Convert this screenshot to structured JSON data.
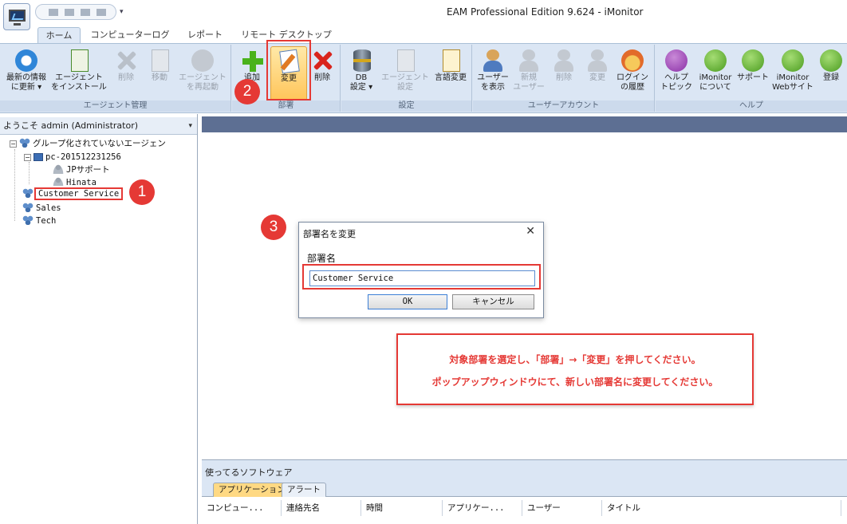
{
  "window": {
    "title": "EAM Professional Edition 9.624 - iMonitor",
    "qat_dropdown_glyph": "▾"
  },
  "ribbon_tabs": [
    {
      "label": "ホーム"
    },
    {
      "label": "コンピューターログ"
    },
    {
      "label": "レポート"
    },
    {
      "label": "リモート デスクトップ"
    }
  ],
  "ribbon": {
    "agent_mgmt": {
      "group_label": "エージェント管理",
      "buttons": [
        {
          "label": "最新の情報\nに更新 ▾",
          "icon": "refresh-icon"
        },
        {
          "label": "エージェント\nをインストール",
          "icon": "install-agent-icon"
        },
        {
          "label": "削除",
          "icon": "delete-icon"
        },
        {
          "label": "移動",
          "icon": "move-icon"
        },
        {
          "label": "エージェント\nを再起動",
          "icon": "restart-icon"
        }
      ]
    },
    "department": {
      "group_label": "部署",
      "buttons": [
        {
          "label": "追加",
          "icon": "add-icon"
        },
        {
          "label": "変更",
          "icon": "edit-icon"
        },
        {
          "label": "削除",
          "icon": "delete-icon"
        }
      ]
    },
    "settings": {
      "group_label": "設定",
      "buttons": [
        {
          "label": "DB\n設定 ▾",
          "icon": "database-icon"
        },
        {
          "label": "エージェント\n設定",
          "icon": "agent-settings-icon"
        },
        {
          "label": "言語変更",
          "icon": "language-icon"
        }
      ]
    },
    "user_account": {
      "group_label": "ユーザーアカウント",
      "buttons": [
        {
          "label": "ユーザー\nを表示",
          "icon": "users-icon"
        },
        {
          "label": "新規\nユーザー",
          "icon": "new-user-icon"
        },
        {
          "label": "削除",
          "icon": "delete-user-icon"
        },
        {
          "label": "変更",
          "icon": "edit-user-icon"
        },
        {
          "label": "ログイン\nの履歴",
          "icon": "login-history-icon"
        }
      ]
    },
    "help": {
      "group_label": "ヘルプ",
      "buttons": [
        {
          "label": "ヘルプ\nトピック",
          "icon": "help-icon"
        },
        {
          "label": "iMonitor\nについて",
          "icon": "about-icon"
        },
        {
          "label": "サポート",
          "icon": "support-icon"
        },
        {
          "label": "iMonitor\nWebサイト",
          "icon": "website-icon"
        },
        {
          "label": "登録",
          "icon": "register-icon"
        }
      ]
    }
  },
  "left_panel": {
    "welcome": "ようこそ admin (Administrator)",
    "dropdown_glyph": "▾",
    "tree": {
      "ungrouped": "グループ化されていないエージェン",
      "pc": "pc-201512231256",
      "users": [
        "JPサポート",
        "Hinata"
      ],
      "departments": [
        "Customer Service",
        "Sales",
        "Tech"
      ],
      "expand_glyph": "−"
    }
  },
  "dialog": {
    "title": "部署名を変更",
    "close_glyph": "✕",
    "field_label": "部署名",
    "value": "Customer Service",
    "ok_label": "OK",
    "cancel_label": "キャンセル"
  },
  "instruction": {
    "line1": "対象部署を選定し、「部署」→「変更」を押してください。",
    "line2": "ポップアップウィンドウにて、新しい部署名に変更してください。"
  },
  "steps": [
    "1",
    "2",
    "3"
  ],
  "software_panel": {
    "title": "使ってるソフトウェア",
    "tabs": [
      "アプリケーション",
      "アラート"
    ],
    "columns": [
      "コンピュー...",
      "連絡先名",
      "時間",
      "アプリケー...",
      "ユーザー",
      "タイトル"
    ]
  },
  "colors": {
    "annotation_red": "#e53935",
    "ribbon_bg": "#dbe6f4",
    "main_header": "#5d6f93",
    "highlight_button": "#ffc55a"
  }
}
